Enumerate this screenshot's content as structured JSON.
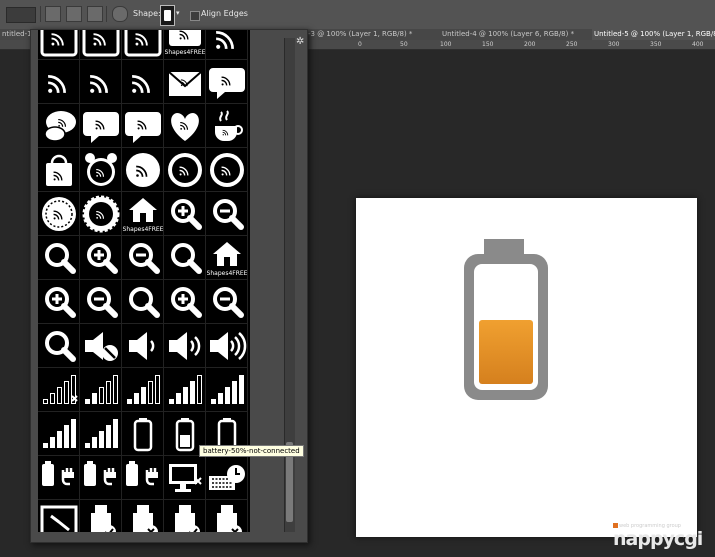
{
  "options_bar": {
    "shape_label": "Shape:",
    "align_edges_label": "Align Edges"
  },
  "tabs": [
    {
      "label": "ntitled-1 @"
    },
    {
      "label": "-3 @ 100% (Layer 1, RGB/8) *"
    },
    {
      "label": "Untitled-4 @ 100% (Layer 6, RGB/8) *"
    },
    {
      "label": "Untitled-5 @ 100% (Layer 1, RGB/8) *"
    }
  ],
  "ruler": [
    "0",
    "50",
    "100",
    "150",
    "200",
    "250",
    "300",
    "350",
    "400"
  ],
  "tooltip": "battery-50%-not-connected",
  "icon_grid": {
    "columns": 5,
    "items": [
      "framed-rss-icon",
      "framed-rss-icon",
      "framed-rss-icon",
      "shapes4free-rss-icon",
      "rss-icon",
      "rss-icon",
      "rss-icon",
      "rss-icon",
      "rss-envelope-icon",
      "rss-speech-bubble-icon",
      "rss-speech-bubbles-icon",
      "rss-speech-bubble-icon",
      "rss-speech-bubble-icon",
      "rss-heart-icon",
      "rss-coffee-cup-icon",
      "rss-shopping-bag-icon",
      "rss-alarm-clock-icon",
      "rss-badge-icon",
      "rss-circle-icon",
      "rss-circle-icon",
      "rss-dotted-circle-icon",
      "rss-gear-icon",
      "shapes4free-house-icon",
      "zoom-in-icon",
      "zoom-out-icon",
      "search-icon",
      "zoom-in-icon",
      "zoom-out-icon",
      "search-icon",
      "shapes4free-house-icon",
      "zoom-in-icon",
      "zoom-out-icon",
      "search-icon",
      "zoom-in-icon",
      "zoom-out-icon",
      "search-icon",
      "mute-icon",
      "speaker-low-icon",
      "speaker-medium-icon",
      "speaker-high-icon",
      "signal-none-icon",
      "signal-low-icon",
      "signal-medium-icon",
      "signal-high-icon",
      "signal-full-icon",
      "signal-full-icon",
      "signal-full-icon",
      "battery-empty-icon",
      "battery-half-icon",
      "battery-outline-icon",
      "battery-plug-icon",
      "battery-plug-icon",
      "battery-plug-icon",
      "computer-unplugged-icon",
      "keyboard-clock-icon",
      "clock-icon",
      "usb-check-icon",
      "usb-cross-icon",
      "usb-check-icon",
      "usb-cross-icon"
    ]
  },
  "canvas_icon": {
    "name": "battery-half-icon",
    "charge_level": 0.5,
    "body_color": "#8a8a8a",
    "fill_color": "#e5902c"
  },
  "watermark": {
    "sub": "web programming group",
    "brand": "nappycgi"
  }
}
